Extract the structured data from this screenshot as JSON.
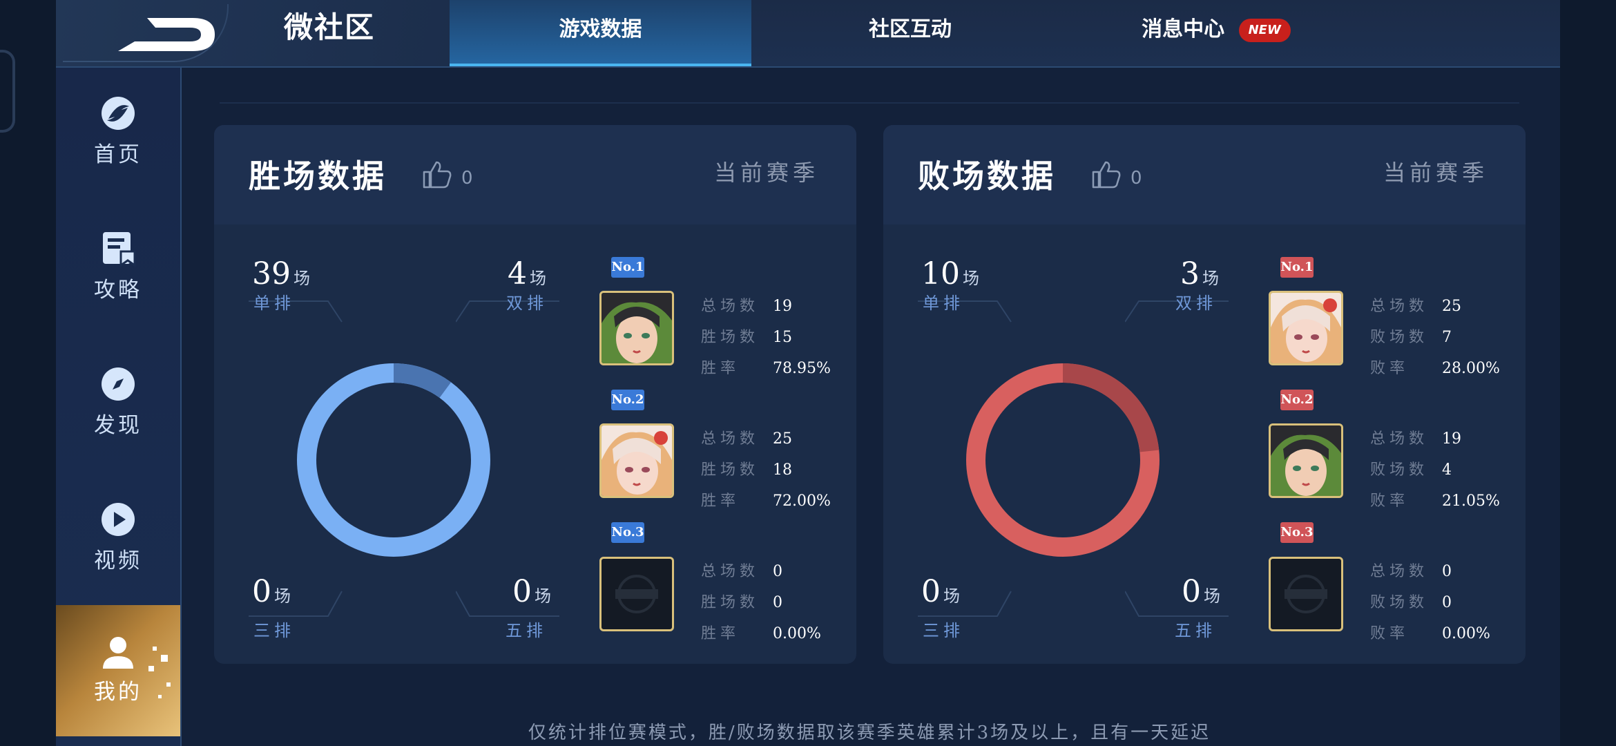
{
  "header": {
    "brand_title": "微社区",
    "tabs": [
      {
        "label": "游戏数据",
        "active": true
      },
      {
        "label": "社区互动",
        "active": false
      },
      {
        "label": "消息中心",
        "active": false,
        "badge": "NEW"
      }
    ]
  },
  "sidebar": {
    "items": [
      {
        "label": "首页",
        "icon": "home-icon"
      },
      {
        "label": "攻略",
        "icon": "guide-icon"
      },
      {
        "label": "发现",
        "icon": "compass-icon"
      },
      {
        "label": "视频",
        "icon": "play-icon"
      },
      {
        "label": "我的",
        "icon": "user-icon",
        "active": true
      }
    ]
  },
  "colors": {
    "win_accent": "#7ab0f4",
    "win_dark": "#4a74b0",
    "loss_accent": "#d8605f",
    "loss_dark": "#a8474a",
    "badge_win": "#3a7ad8",
    "badge_loss": "#d05458",
    "new_badge": "#c8201c"
  },
  "win_panel": {
    "title": "胜场数据",
    "likes": "0",
    "season": "当前赛季",
    "solo": {
      "value": "39",
      "unit": "场",
      "label": "单排"
    },
    "duo": {
      "value": "4",
      "unit": "场",
      "label": "双排"
    },
    "trio": {
      "value": "0",
      "unit": "场",
      "label": "三排"
    },
    "five": {
      "value": "0",
      "unit": "场",
      "label": "五排"
    },
    "heroes": [
      {
        "rank": "No.1",
        "stats": [
          {
            "k": "总场数",
            "v": "19"
          },
          {
            "k": "胜场数",
            "v": "15"
          },
          {
            "k": "胜率",
            "v": "78.95%"
          }
        ]
      },
      {
        "rank": "No.2",
        "stats": [
          {
            "k": "总场数",
            "v": "25"
          },
          {
            "k": "胜场数",
            "v": "18"
          },
          {
            "k": "胜率",
            "v": "72.00%"
          }
        ]
      },
      {
        "rank": "No.3",
        "stats": [
          {
            "k": "总场数",
            "v": "0"
          },
          {
            "k": "胜场数",
            "v": "0"
          },
          {
            "k": "胜率",
            "v": "0.00%"
          }
        ]
      }
    ]
  },
  "loss_panel": {
    "title": "败场数据",
    "likes": "0",
    "season": "当前赛季",
    "solo": {
      "value": "10",
      "unit": "场",
      "label": "单排"
    },
    "duo": {
      "value": "3",
      "unit": "场",
      "label": "双排"
    },
    "trio": {
      "value": "0",
      "unit": "场",
      "label": "三排"
    },
    "five": {
      "value": "0",
      "unit": "场",
      "label": "五排"
    },
    "heroes": [
      {
        "rank": "No.1",
        "stats": [
          {
            "k": "总场数",
            "v": "25"
          },
          {
            "k": "败场数",
            "v": "7"
          },
          {
            "k": "败率",
            "v": "28.00%"
          }
        ]
      },
      {
        "rank": "No.2",
        "stats": [
          {
            "k": "总场数",
            "v": "19"
          },
          {
            "k": "败场数",
            "v": "4"
          },
          {
            "k": "败率",
            "v": "21.05%"
          }
        ]
      },
      {
        "rank": "No.3",
        "stats": [
          {
            "k": "总场数",
            "v": "0"
          },
          {
            "k": "败场数",
            "v": "0"
          },
          {
            "k": "败率",
            "v": "0.00%"
          }
        ]
      }
    ]
  },
  "footnote": "仅统计排位赛模式，胜/败场数据取该赛季英雄累计3场及以上，且有一天延迟"
}
